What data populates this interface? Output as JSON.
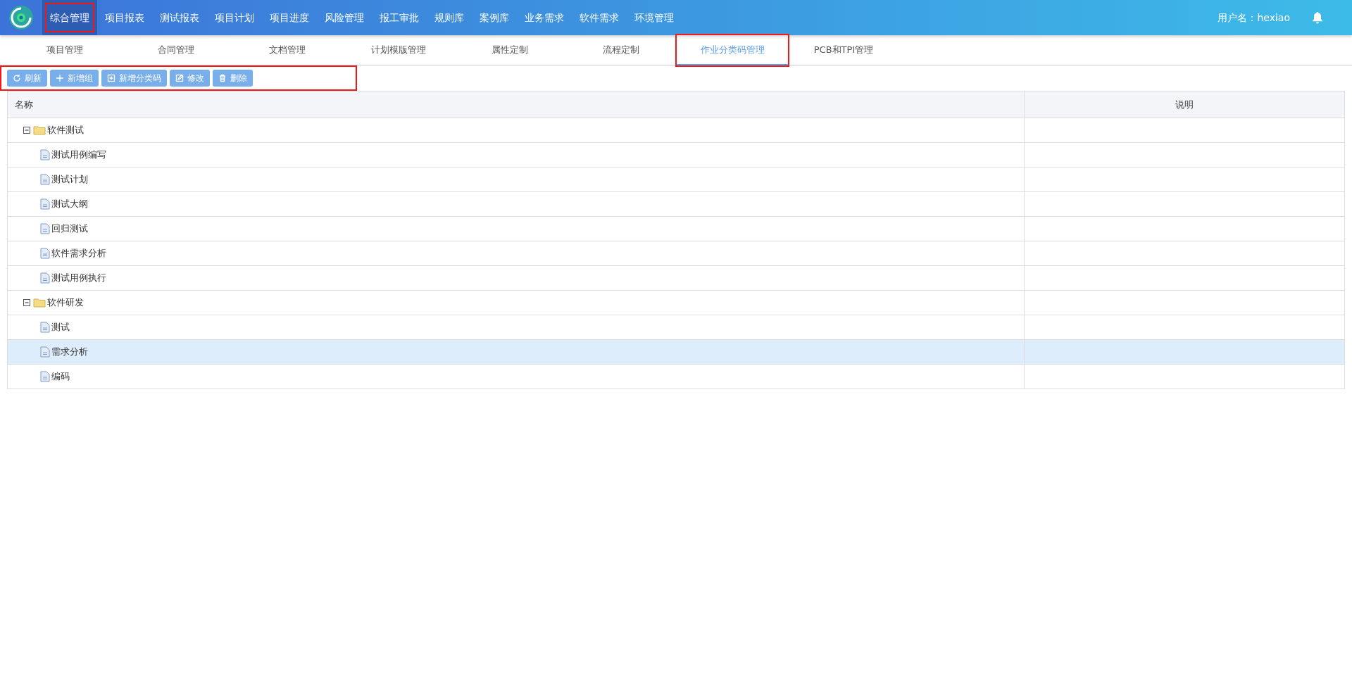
{
  "top_nav": {
    "items": [
      {
        "label": "综合管理",
        "selected": true,
        "highlighted": true
      },
      {
        "label": "项目报表",
        "selected": false,
        "highlighted": false
      },
      {
        "label": "测试报表",
        "selected": false,
        "highlighted": false
      },
      {
        "label": "项目计划",
        "selected": false,
        "highlighted": false
      },
      {
        "label": "项目进度",
        "selected": false,
        "highlighted": false
      },
      {
        "label": "风险管理",
        "selected": false,
        "highlighted": false
      },
      {
        "label": "报工审批",
        "selected": false,
        "highlighted": false
      },
      {
        "label": "规则库",
        "selected": false,
        "highlighted": false
      },
      {
        "label": "案例库",
        "selected": false,
        "highlighted": false
      },
      {
        "label": "业务需求",
        "selected": false,
        "highlighted": false
      },
      {
        "label": "软件需求",
        "selected": false,
        "highlighted": false
      },
      {
        "label": "环境管理",
        "selected": false,
        "highlighted": false
      }
    ],
    "user": "用户名：hexiao"
  },
  "tabs": [
    {
      "label": "项目管理",
      "selected": false,
      "highlighted": false
    },
    {
      "label": "合同管理",
      "selected": false,
      "highlighted": false
    },
    {
      "label": "文档管理",
      "selected": false,
      "highlighted": false
    },
    {
      "label": "计划模版管理",
      "selected": false,
      "highlighted": false
    },
    {
      "label": "属性定制",
      "selected": false,
      "highlighted": false
    },
    {
      "label": "流程定制",
      "selected": false,
      "highlighted": false
    },
    {
      "label": "作业分类码管理",
      "selected": true,
      "highlighted": true
    },
    {
      "label": "PCB和TPI管理",
      "selected": false,
      "highlighted": false
    }
  ],
  "toolbar": {
    "highlighted": true,
    "buttons": [
      {
        "label": "刷新",
        "kind": "refresh"
      },
      {
        "label": "新增组",
        "kind": "plus"
      },
      {
        "label": "新增分类码",
        "kind": "plusbox"
      },
      {
        "label": "修改",
        "kind": "edit"
      },
      {
        "label": "删除",
        "kind": "trash"
      }
    ]
  },
  "table": {
    "columns": [
      "名称",
      "说明"
    ],
    "rows": [
      {
        "name": "软件测试",
        "expanded": true,
        "selected": false,
        "children": [
          {
            "name": "测试用例编写",
            "selected": false
          },
          {
            "name": "测试计划",
            "selected": false
          },
          {
            "name": "测试大纲",
            "selected": false
          },
          {
            "name": "回归测试",
            "selected": false
          },
          {
            "name": "软件需求分析",
            "selected": false
          },
          {
            "name": "测试用例执行",
            "selected": false
          }
        ]
      },
      {
        "name": "软件研发",
        "expanded": true,
        "selected": false,
        "children": [
          {
            "name": "测试",
            "selected": false
          },
          {
            "name": "需求分析",
            "selected": true
          },
          {
            "name": "编码",
            "selected": false
          }
        ]
      }
    ]
  }
}
